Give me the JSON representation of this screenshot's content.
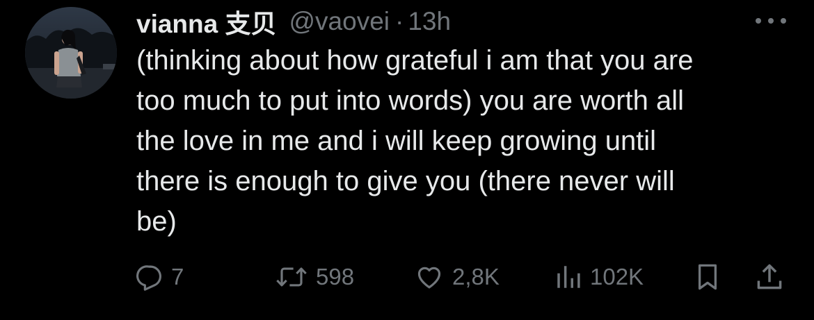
{
  "tweet": {
    "display_name": "vianna 支贝",
    "handle": "@vaovei",
    "separator": "·",
    "time": "13h",
    "text": "(thinking about how grateful i am that you are\ntoo much to put into words) you are worth all\nthe love in me and i will keep growing until\nthere is enough to give you (there never will\nbe)"
  },
  "actions": {
    "replies": "7",
    "reposts": "598",
    "likes": "2,8K",
    "views": "102K"
  },
  "icons": {
    "more": "more-horizontal-icon",
    "reply": "speech-bubble-icon",
    "repost": "retweet-arrows-icon",
    "like": "heart-icon",
    "views": "bar-chart-icon",
    "bookmark": "bookmark-icon",
    "share": "share-upload-icon"
  },
  "colors": {
    "background": "#000000",
    "primary_text": "#e7e9ea",
    "secondary_text": "#71767b"
  }
}
